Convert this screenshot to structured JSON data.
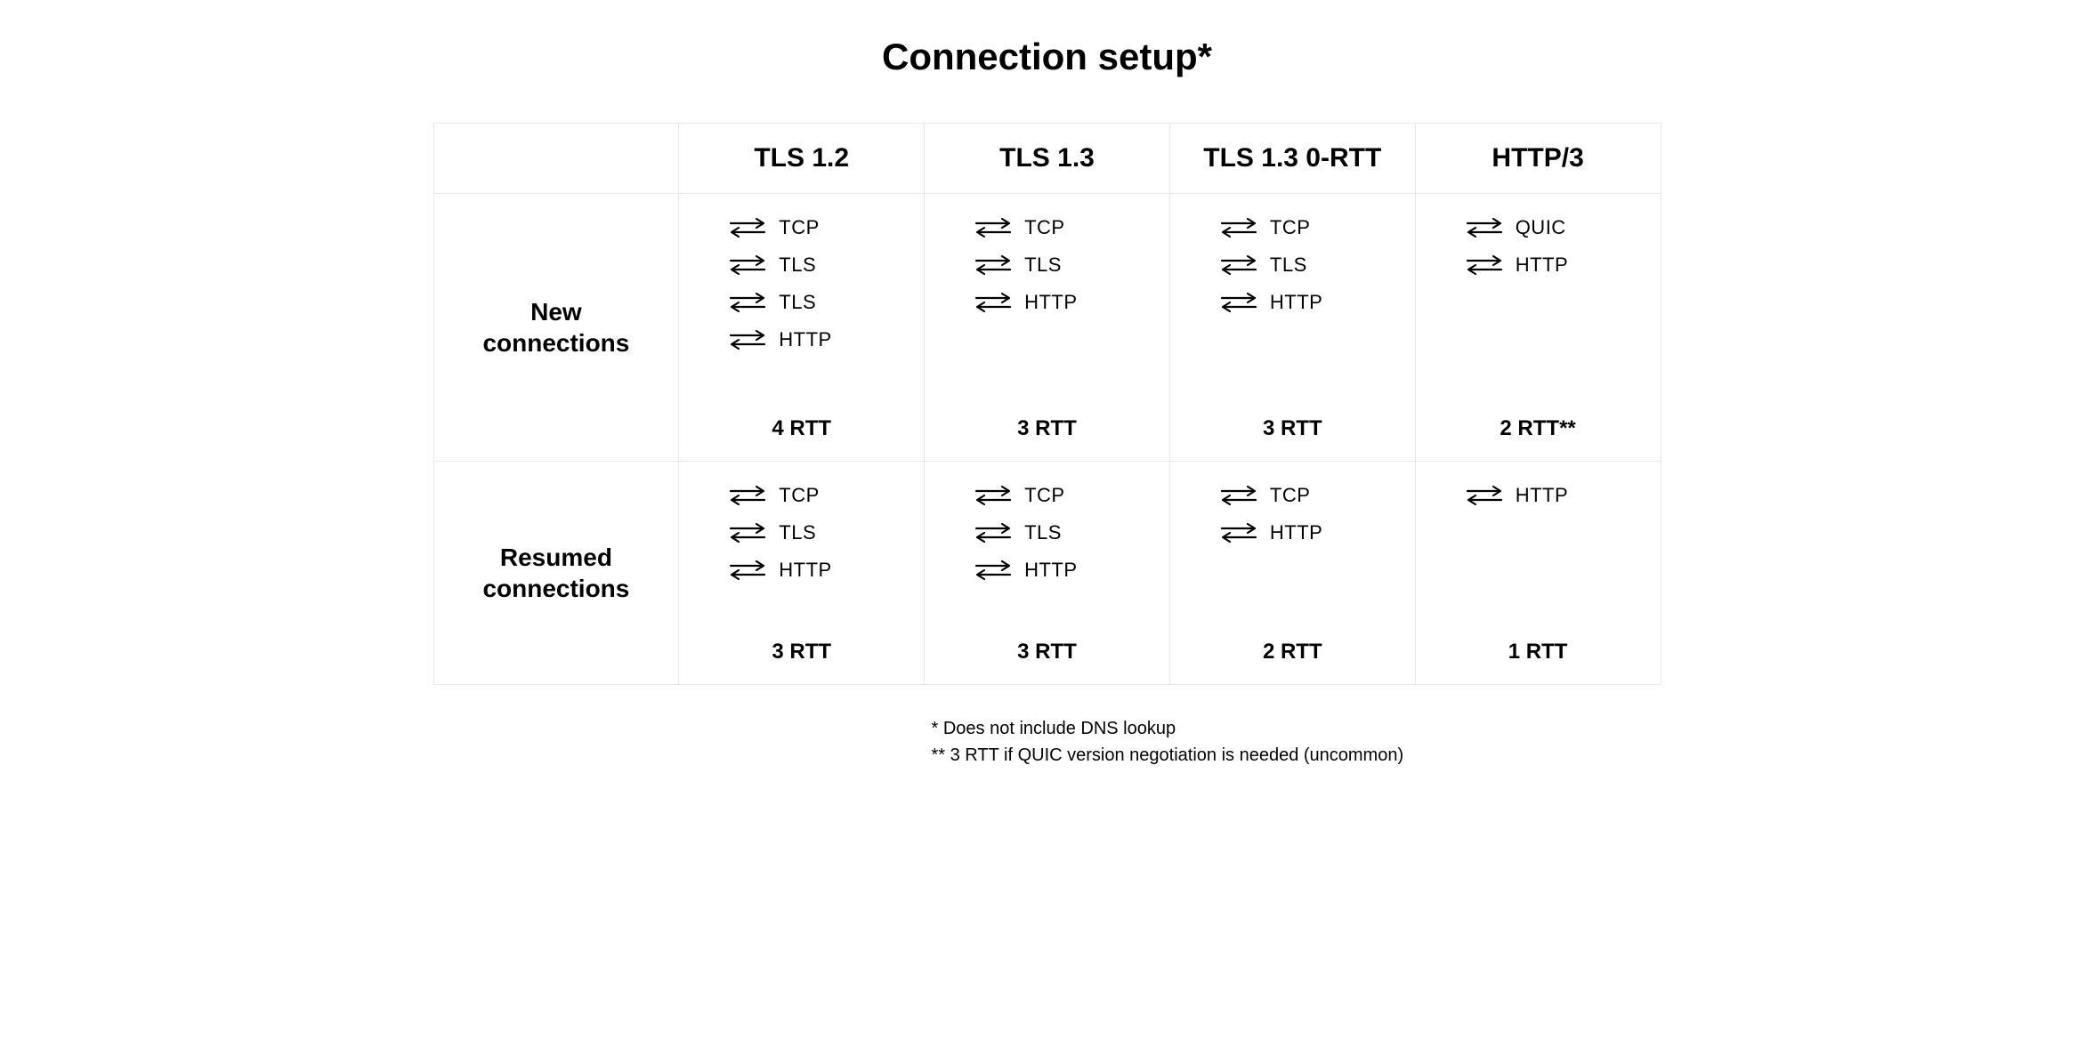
{
  "title": "Connection setup*",
  "columns": [
    "TLS 1.2",
    "TLS 1.3",
    "TLS 1.3 0-RTT",
    "HTTP/3"
  ],
  "rows": {
    "new": {
      "label_line1": "New",
      "label_line2": "connections"
    },
    "resumed": {
      "label_line1": "Resumed",
      "label_line2": "connections"
    }
  },
  "cells": {
    "new": {
      "tls12": {
        "steps": [
          "TCP",
          "TLS",
          "TLS",
          "HTTP"
        ],
        "rtt": "4 RTT"
      },
      "tls13": {
        "steps": [
          "TCP",
          "TLS",
          "HTTP"
        ],
        "rtt": "3 RTT"
      },
      "tls130": {
        "steps": [
          "TCP",
          "TLS",
          "HTTP"
        ],
        "rtt": "3 RTT"
      },
      "http3": {
        "steps": [
          "QUIC",
          "HTTP"
        ],
        "rtt": "2 RTT**"
      }
    },
    "resumed": {
      "tls12": {
        "steps": [
          "TCP",
          "TLS",
          "HTTP"
        ],
        "rtt": "3 RTT"
      },
      "tls13": {
        "steps": [
          "TCP",
          "TLS",
          "HTTP"
        ],
        "rtt": "3 RTT"
      },
      "tls130": {
        "steps": [
          "TCP",
          "HTTP"
        ],
        "rtt": "2 RTT"
      },
      "http3": {
        "steps": [
          "HTTP"
        ],
        "rtt": "1 RTT"
      }
    }
  },
  "captions": {
    "line1": "* Does not include DNS lookup",
    "line2": "** 3 RTT if QUIC version negotiation is needed (uncommon)"
  },
  "icon_names": {
    "exchange": "bidirectional-arrow-icon"
  }
}
